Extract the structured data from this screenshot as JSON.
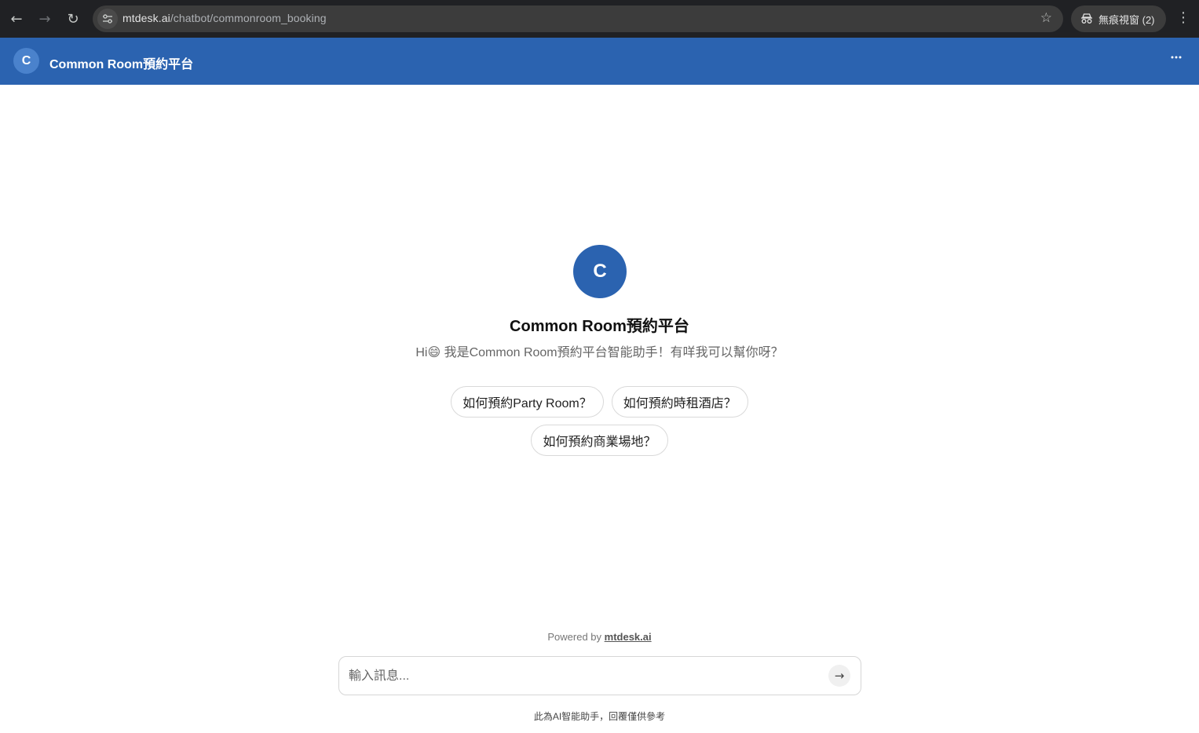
{
  "browser": {
    "url_host": "mtdesk.ai",
    "url_path": "/chatbot/commonroom_booking",
    "incognito_label": "無痕視窗 (2)"
  },
  "header": {
    "avatar_letter": "C",
    "title": "Common Room預約平台"
  },
  "welcome": {
    "avatar_letter": "C",
    "bot_name": "Common Room預約平台",
    "greeting": "Hi😄 我是Common Room預約平台智能助手！有咩我可以幫你呀？"
  },
  "suggestions": [
    "如何預約Party Room？",
    "如何預約時租酒店？",
    "如何預約商業場地？"
  ],
  "footer": {
    "powered_prefix": "Powered by ",
    "powered_link": "mtdesk.ai",
    "input_placeholder": "輸入訊息...",
    "disclaimer": "此為AI智能助手，回覆僅供參考"
  },
  "colors": {
    "brand": "#2b63b0",
    "chrome_bg": "#202124"
  }
}
